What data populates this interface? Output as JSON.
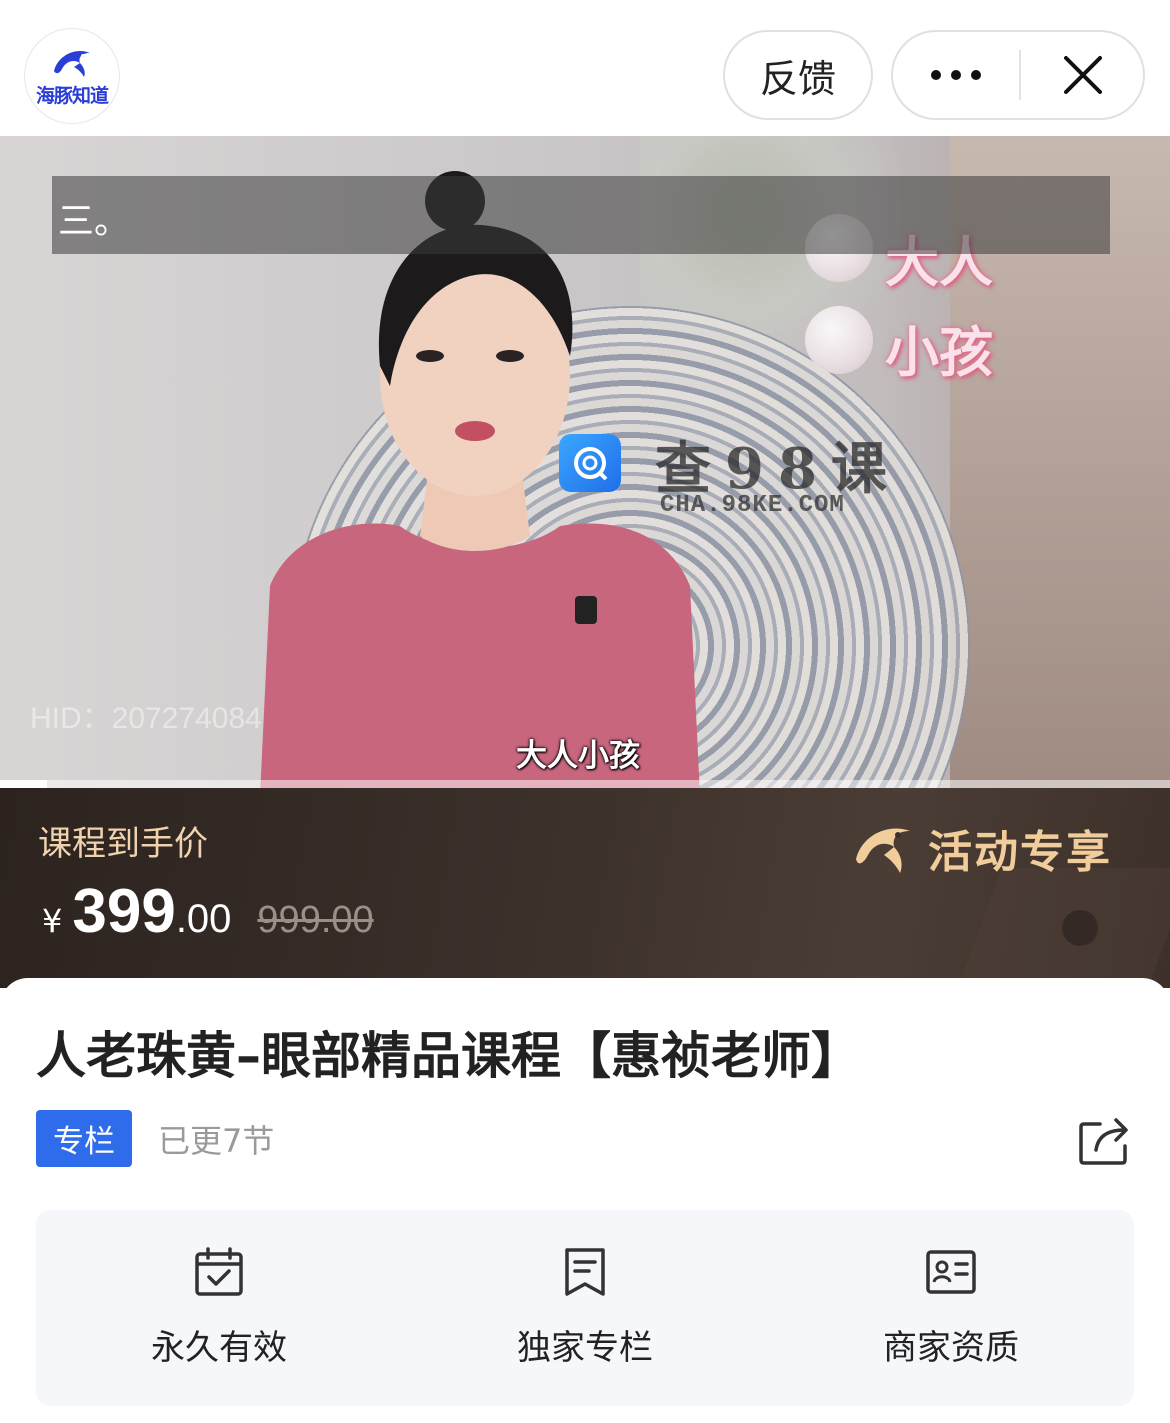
{
  "header": {
    "logo_text": "海豚知道",
    "feedback_label": "反馈",
    "more_icon": "more-dots-icon",
    "close_icon": "close-icon"
  },
  "video": {
    "overlay_text": "三。",
    "hid_text": "HID：207274084",
    "subtitle": "大人小孩",
    "tags": [
      "大人",
      "小孩"
    ],
    "watermark_title": "查98课",
    "watermark_url": "CHA.98KE.COM",
    "progress_fraction": 0.04
  },
  "price": {
    "label": "课程到手价",
    "currency": "¥",
    "integer": "399",
    "decimal": ".00",
    "original": "999.00",
    "activity_label": "活动专享",
    "accent_color": "#f2cd9c"
  },
  "course": {
    "title": "人老珠黄–眼部精品课程【惠祯老师】",
    "badge": "专栏",
    "updated": "已更7节",
    "share_icon": "share-icon",
    "badge_color": "#2f6cec"
  },
  "features": [
    {
      "icon": "calendar-check-icon",
      "label": "永久有效"
    },
    {
      "icon": "bookmark-list-icon",
      "label": "独家专栏"
    },
    {
      "icon": "id-card-icon",
      "label": "商家资质"
    }
  ]
}
